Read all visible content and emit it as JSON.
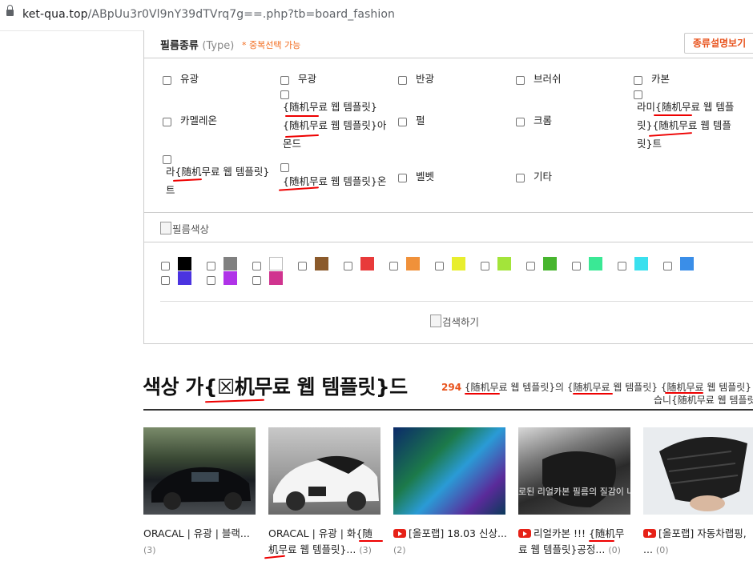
{
  "browser": {
    "url_host": "ket-qua.top",
    "url_path": "/ABpUu3r0Vl9nY39dTVrq7g==.php?tb=board_fashion"
  },
  "filter": {
    "title": "필름종류",
    "title_sub": "(Type)",
    "multi_note": "* 중복선택 가능",
    "type_help_button": "종류설명보기",
    "types": {
      "t1": "유광",
      "t2": "무광",
      "t3": "반광",
      "t4": "브러쉬",
      "t5": "카본",
      "t6": "카멜레온",
      "t7a": "{随机무료 웹 템플릿}",
      "t7b": "{随机무료 웹 템플릿}아",
      "t7c": "몬드",
      "t8": "펄",
      "t9": "크롬",
      "t10a": "라미{随机무료 웹 템플",
      "t10b": "릿}{随机무료 웹 템플",
      "t10c": "릿}트",
      "t11a": "라{随机무료 웹 템플릿}",
      "t11b": "트",
      "t12": "{随机무료 웹 템플릿}온",
      "t13": "벨벳",
      "t14": "기타"
    },
    "color_header": "필름색상",
    "search_button": "검색하기",
    "swatch_colors": [
      "#000000",
      "#808080",
      "#ffffff",
      "#8b5a2b",
      "#e83a3a",
      "#f0913a",
      "#e8ee2e",
      "#a3e43a",
      "#47b52e",
      "#3ae895",
      "#3ae0ee",
      "#3a8ee8",
      "#4b33e0",
      "#b033e8",
      "#d0348f"
    ]
  },
  "section": {
    "heading": "색상 가{☒机무료 웹 템플릿}드",
    "count": "294",
    "count_text": " {随机무료 웹 템플릿}의 {随机무료 웹 템플릿} {随机무료 웹 템플릿}",
    "count_text2": "습니{随机무료 웹 템플릿}"
  },
  "videos": [
    {
      "l1": "ORACAL | 유광 | 블랙...",
      "l2": "",
      "count": "(3)",
      "yt": false
    },
    {
      "l1": "ORACAL | 유광 | 화{随",
      "l2": "机무료 웹 템플릿}...",
      "count": "(3)",
      "yt": false
    },
    {
      "l1": "[올포랩] 18.03 신상...",
      "l2": "",
      "count": "(2)",
      "yt": true
    },
    {
      "l1": "리얼카본 !!! {随机무",
      "l2": "료 웹 템플릿}공정...",
      "count": "(0)",
      "yt": true
    },
    {
      "l1": "[올포랩] 자동차랩핑,",
      "l2": "...",
      "count": "(0)",
      "yt": true
    }
  ],
  "overlay_text": "로된 리얼카본 필름의 질감이 나타"
}
